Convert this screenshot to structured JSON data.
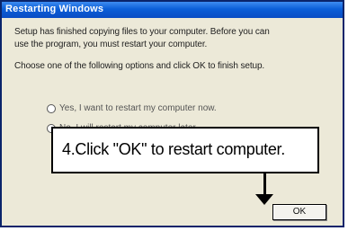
{
  "window": {
    "title": "Restarting Windows"
  },
  "message": {
    "line1": "Setup has finished copying files to your computer.  Before you can",
    "line2": "use the program, you must restart your computer.",
    "line3": "Choose one of the following options and click OK to finish setup."
  },
  "options": [
    {
      "label": "Yes, I want to restart my computer now.",
      "selected": true
    },
    {
      "label": "No, I will restart my computer later.",
      "selected": false
    }
  ],
  "buttons": {
    "ok_label": "OK"
  },
  "callout": {
    "text": "4.Click \"OK\" to restart computer."
  }
}
